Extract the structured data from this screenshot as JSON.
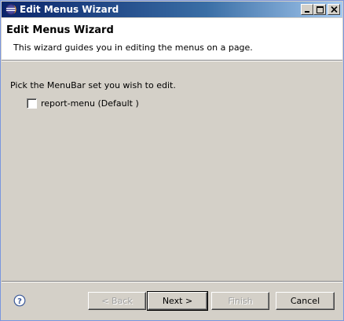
{
  "window": {
    "title": "Edit Menus Wizard",
    "controls": [
      "minimize-icon",
      "maximize-icon",
      "close-icon"
    ]
  },
  "header": {
    "title": "Edit Menus Wizard",
    "description": "This wizard guides you in editing the menus on a page."
  },
  "body": {
    "prompt": "Pick the MenuBar set you wish to edit.",
    "options": [
      {
        "label": "report-menu (Default )",
        "checked": false
      }
    ]
  },
  "footer": {
    "help_icon": "help-icon",
    "back_label": "< Back",
    "next_label": "Next >",
    "finish_label": "Finish",
    "cancel_label": "Cancel",
    "back_enabled": false,
    "finish_enabled": false
  },
  "colors": {
    "titlebar_start": "#0a246a",
    "titlebar_end": "#a6caf0",
    "dialog_bg": "#d4d0c8",
    "header_bg": "#ffffff"
  }
}
